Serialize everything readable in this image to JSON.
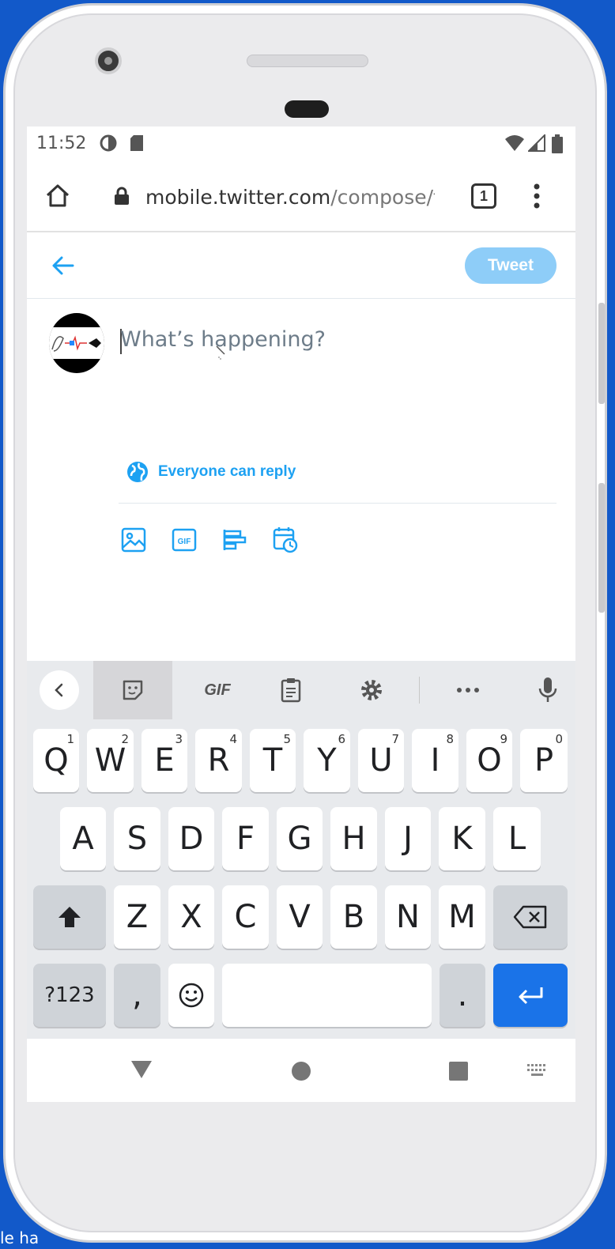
{
  "desktop": {
    "label": "le  ha"
  },
  "status_bar": {
    "time": "11:52"
  },
  "browser": {
    "url_host": "mobile.twitter.com",
    "url_path": "/compose/t",
    "tab_count": "1"
  },
  "compose": {
    "tweet_button": "Tweet",
    "placeholder": "What’s happening?",
    "reply_setting": "Everyone can reply",
    "toolbar_icons": [
      "image-icon",
      "gif-icon",
      "poll-icon",
      "schedule-icon"
    ]
  },
  "keyboard": {
    "toolbar": {
      "gif_label": "GIF"
    },
    "row1": [
      {
        "key": "Q",
        "hint": "1"
      },
      {
        "key": "W",
        "hint": "2"
      },
      {
        "key": "E",
        "hint": "3"
      },
      {
        "key": "R",
        "hint": "4"
      },
      {
        "key": "T",
        "hint": "5"
      },
      {
        "key": "Y",
        "hint": "6"
      },
      {
        "key": "U",
        "hint": "7"
      },
      {
        "key": "I",
        "hint": "8"
      },
      {
        "key": "O",
        "hint": "9"
      },
      {
        "key": "P",
        "hint": "0"
      }
    ],
    "row2": [
      "A",
      "S",
      "D",
      "F",
      "G",
      "H",
      "J",
      "K",
      "L"
    ],
    "row3": [
      "Z",
      "X",
      "C",
      "V",
      "B",
      "N",
      "M"
    ],
    "row4": {
      "symbols": "?123",
      "comma": ",",
      "period": "."
    }
  },
  "colors": {
    "accent": "#1da1f2",
    "tweet_button_disabled": "#8ecdf8",
    "enter_key": "#1a73e8"
  }
}
